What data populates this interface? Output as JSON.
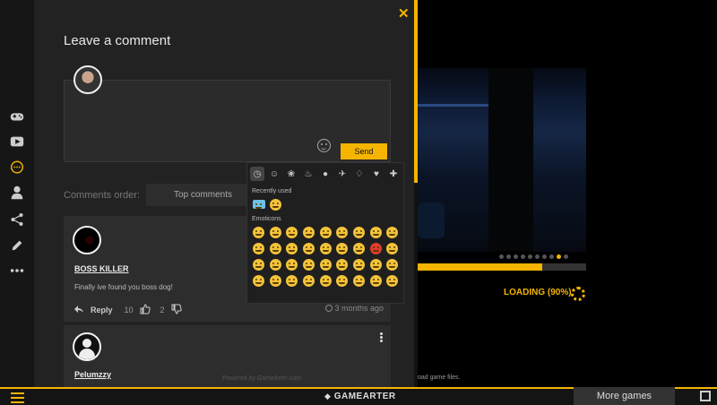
{
  "panel": {
    "title": "Leave a comment",
    "send_label": "Send",
    "order_label": "Comments order:",
    "order_value": "Top comments",
    "powered_by": "Powered by GameArter.com"
  },
  "comments": [
    {
      "author": "BOSS KILLER",
      "text": "Finally ive found you boss dog!",
      "reply_label": "Reply",
      "likes": "10",
      "dislikes": "2",
      "time": "3 months ago"
    },
    {
      "author": "Pelumzzy"
    }
  ],
  "emoji_picker": {
    "recent_label": "Recently used",
    "emoticons_label": "Emoticons",
    "categories": [
      "clock-icon",
      "smiley-icon",
      "animal-icon",
      "food-icon",
      "ball-icon",
      "rocket-icon",
      "bulb-icon",
      "heart-icon",
      "flag-icon"
    ]
  },
  "game": {
    "loading_text": "LOADING (90%)",
    "progress": 0.74,
    "status_text": "oad game files.",
    "dots_total": 10,
    "dots_active_index": 8
  },
  "bottombar": {
    "brand": "GAMEARTER",
    "more_games": "More games"
  },
  "colors": {
    "accent": "#f4b400",
    "panel": "#222222",
    "card": "#2d2d2d"
  }
}
